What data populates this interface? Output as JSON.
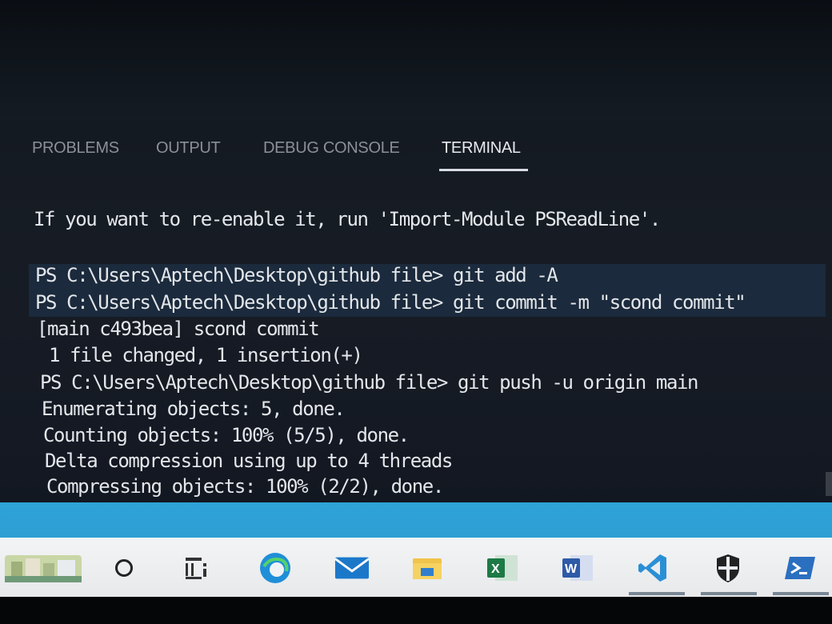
{
  "panel": {
    "tabs": [
      {
        "label": "PROBLEMS"
      },
      {
        "label": "OUTPUT"
      },
      {
        "label": "DEBUG CONSOLE"
      },
      {
        "label": "TERMINAL"
      }
    ],
    "active_tab": "TERMINAL"
  },
  "terminal": {
    "lines": [
      "If you want to re-enable it, run 'Import-Module PSReadLine'.",
      "PS C:\\Users\\Aptech\\Desktop\\github file> git add -A",
      "PS C:\\Users\\Aptech\\Desktop\\github file> git commit -m \"scond commit\"",
      "[main c493bea] scond commit",
      " 1 file changed, 1 insertion(+)",
      "PS C:\\Users\\Aptech\\Desktop\\github file> git push -u origin main",
      "Enumerating objects: 5, done.",
      "Counting objects: 100% (5/5), done.",
      "Delta compression using up to 4 threads",
      "Compressing objects: 100% (2/2), done."
    ]
  },
  "taskbar": {
    "icons": [
      {
        "name": "widgets-weather-icon"
      },
      {
        "name": "search-icon"
      },
      {
        "name": "task-view-icon"
      },
      {
        "name": "edge-browser-icon"
      },
      {
        "name": "mail-icon"
      },
      {
        "name": "file-explorer-icon"
      },
      {
        "name": "excel-icon"
      },
      {
        "name": "word-icon"
      },
      {
        "name": "vscode-icon"
      },
      {
        "name": "windows-security-icon"
      },
      {
        "name": "powershell-icon"
      }
    ],
    "colors": {
      "accent": "#2d9fd4",
      "edge": "#1f8fd8",
      "mail": "#1b78c9",
      "excel": "#1d7a45",
      "word": "#2f5aa8",
      "vscode": "#2a8fd6",
      "powershell": "#2b6fc0"
    }
  }
}
